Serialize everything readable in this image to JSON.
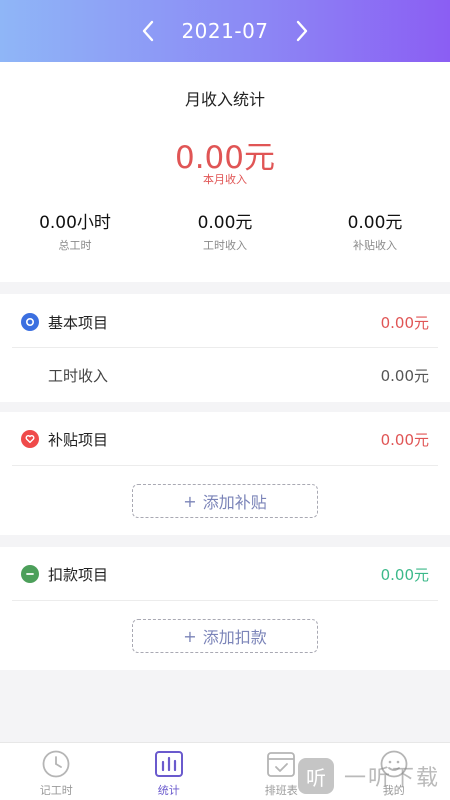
{
  "header": {
    "month": "2021-07"
  },
  "summary": {
    "title": "月收入统计",
    "month_income": "0.00元",
    "month_income_label": "本月收入",
    "stats": [
      {
        "value": "0.00小时",
        "label": "总工时"
      },
      {
        "value": "0.00元",
        "label": "工时收入"
      },
      {
        "value": "0.00元",
        "label": "补贴收入"
      }
    ]
  },
  "basic": {
    "title": "基本项目",
    "amount": "0.00元",
    "sub_label": "工时收入",
    "sub_amount": "0.00元"
  },
  "subsidy": {
    "title": "补贴项目",
    "amount": "0.00元",
    "add_label": "添加补贴"
  },
  "deduction": {
    "title": "扣款项目",
    "amount": "0.00元",
    "add_label": "添加扣款"
  },
  "tabs": [
    {
      "label": "记工时",
      "icon": "clock-icon"
    },
    {
      "label": "统计",
      "icon": "bar-chart-icon"
    },
    {
      "label": "排班表",
      "icon": "calendar-icon"
    },
    {
      "label": "我的",
      "icon": "profile-icon"
    }
  ],
  "watermark": {
    "badge": "听",
    "text": "一听下载"
  },
  "colors": {
    "income_red": "#e05555",
    "deduction_green": "#3cb98a",
    "basic_blue": "#3b6fe0",
    "subsidy_red": "#ef4a4a",
    "deduction_icon_green": "#4c9f5a",
    "active_tab": "#6a5acd"
  }
}
